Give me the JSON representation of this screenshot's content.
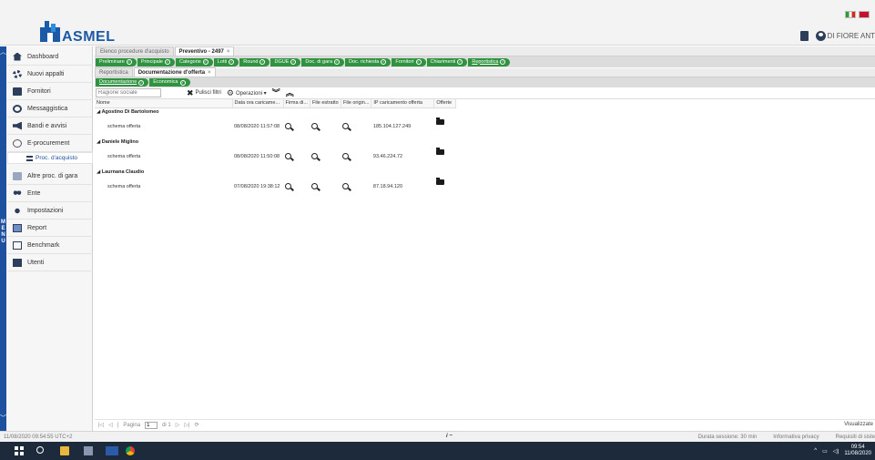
{
  "header": {
    "brand": "ASMEL",
    "user_name": "DI FIORE ANT"
  },
  "sidebar": {
    "menu_label": "M E N U",
    "items": [
      {
        "label": "Dashboard"
      },
      {
        "label": "Nuovi appalti"
      },
      {
        "label": "Fornitori"
      },
      {
        "label": "Messaggistica"
      },
      {
        "label": "Bandi e avvisi"
      },
      {
        "label": "E-procurement"
      },
      {
        "label": "Proc. d'acquisto"
      },
      {
        "label": "Altre proc. di gara"
      },
      {
        "label": "Ente"
      },
      {
        "label": "Impostazioni"
      },
      {
        "label": "Report"
      },
      {
        "label": "Benchmark"
      },
      {
        "label": "Utenti"
      }
    ]
  },
  "tabs": [
    {
      "label": "Elenco procedure d'acquisto"
    },
    {
      "label": "Preventivo - 2497"
    }
  ],
  "steps": [
    {
      "label": "Preliminare"
    },
    {
      "label": "Principale"
    },
    {
      "label": "Categorie"
    },
    {
      "label": "Lotti"
    },
    {
      "label": "Round"
    },
    {
      "label": "DGUE"
    },
    {
      "label": "Doc. di gara"
    },
    {
      "label": "Doc. richiesta"
    },
    {
      "label": "Fornitori"
    },
    {
      "label": "Chiarimenti"
    },
    {
      "label": "Reportistica"
    }
  ],
  "subtabs": [
    {
      "label": "Reportistica"
    },
    {
      "label": "Documentazione d'offerta"
    }
  ],
  "substeps": [
    {
      "label": "Documentazione"
    },
    {
      "label": "Economica"
    }
  ],
  "toolbar": {
    "search_placeholder": "Ragione sociale",
    "clear_label": "Pulisci filtri",
    "operations_label": "Operazioni ▾"
  },
  "grid": {
    "columns": [
      "Nome",
      "Data ora caricame...",
      "Firma di...",
      "File estratto",
      "File origin...",
      "IP caricamento offerta",
      "Offerte"
    ],
    "groups": [
      {
        "name": "Agostino Di Bartolomeo",
        "row": {
          "name": "schema offerta",
          "date": "08/08/2020 11:57:08",
          "ip": "185.104.127.249"
        }
      },
      {
        "name": "Daniele Miglino",
        "row": {
          "name": "schema offerta",
          "date": "08/08/2020 11:50:08",
          "ip": "93.46.224.72"
        }
      },
      {
        "name": "Laurnana Claudio",
        "row": {
          "name": "schema offerta",
          "date": "07/08/2020 19:38:12",
          "ip": "87.18.94.120"
        }
      }
    ]
  },
  "pager": {
    "page_label": "Pagina",
    "page_value": "1",
    "of_label": "di 1",
    "right_text": "Visualizzate"
  },
  "status": {
    "datetime": "11/08/2020 09:54:55 UTC+2",
    "info": "i ~",
    "session": "Durata sessione: 30 min",
    "privacy": "Informativa privacy",
    "requirements": "Requisiti di siste"
  },
  "taskbar": {
    "time": "09:54",
    "date": "11/08/2020"
  }
}
